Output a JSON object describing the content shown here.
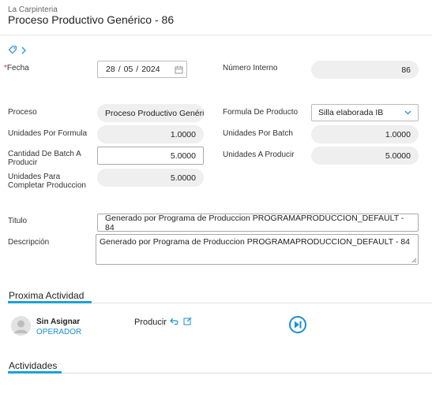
{
  "header": {
    "company": "La Carpinteria",
    "title": "Proceso Productivo Genérico - 86"
  },
  "form": {
    "fecha": {
      "label": "Fecha",
      "required_mark": "*",
      "day": "28",
      "month": "05",
      "year": "2024",
      "sep": "/"
    },
    "numero_interno": {
      "label": "Número Interno",
      "value": "86"
    },
    "proceso": {
      "label": "Proceso",
      "value": "Proceso Productivo Genérico"
    },
    "formula_producto": {
      "label": "Formula De Producto",
      "value": "Silla elaborada IB"
    },
    "unidades_por_formula": {
      "label": "Unidades Por Formula",
      "value": "1.0000"
    },
    "unidades_por_batch": {
      "label": "Unidades Por Batch",
      "value": "1.0000"
    },
    "cantidad_batch": {
      "label_line1": "Cantidad De Batch A",
      "label_line2": "Producir",
      "value": "5.0000"
    },
    "unidades_a_producir": {
      "label": "Unidades A Producir",
      "value": "5.0000"
    },
    "unidades_completar": {
      "label_line1": "Unidades Para",
      "label_line2": "Completar Produccion",
      "value": "5.0000"
    },
    "titulo": {
      "label": "Titulo",
      "value": "Generado por Programa de Produccion PROGRAMAPRODUCCION_DEFAULT - 84"
    },
    "descripcion": {
      "label": "Descripción",
      "value": "Generado por Programa de Produccion PROGRAMAPRODUCCION_DEFAULT - 84"
    }
  },
  "proxima_actividad": {
    "section_title": "Proxima Actividad",
    "user_name": "Sin Asignar",
    "user_role": "OPERADOR",
    "activity_name": "Producir"
  },
  "actividades": {
    "section_title": "Actividades"
  },
  "colors": {
    "accent": "#1aa3d6",
    "link": "#1a8fd0",
    "required": "#dd3333",
    "pill_bg": "#efefef"
  },
  "icons": [
    "tag-icon",
    "chevron-right-icon",
    "calendar-icon",
    "chevron-down-icon",
    "undo-icon",
    "edit-icon",
    "play-next-icon",
    "user-avatar-icon"
  ]
}
